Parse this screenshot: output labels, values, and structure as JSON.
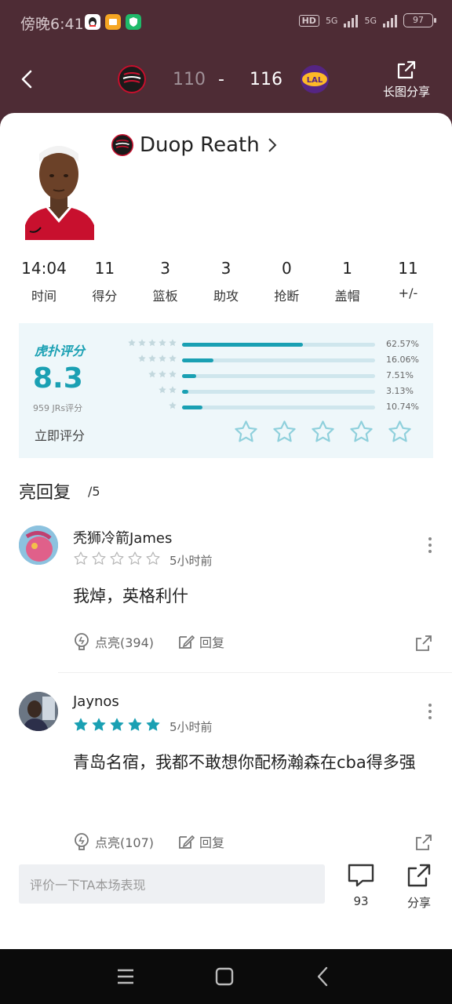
{
  "status_bar": {
    "time": "傍晚6:41",
    "hd": "HD",
    "net1": "5G",
    "net2": "5G",
    "battery": "97"
  },
  "header": {
    "score_home": "110",
    "score_sep": "-",
    "score_away": "116",
    "share_label": "长图分享"
  },
  "player": {
    "name": "Duop Reath"
  },
  "stats": [
    {
      "value": "14:04",
      "label": "时间"
    },
    {
      "value": "11",
      "label": "得分"
    },
    {
      "value": "3",
      "label": "篮板"
    },
    {
      "value": "3",
      "label": "助攻"
    },
    {
      "value": "0",
      "label": "抢断"
    },
    {
      "value": "1",
      "label": "盖帽"
    },
    {
      "value": "11",
      "label": "+/-"
    }
  ],
  "rating": {
    "brand": "虎扑评分",
    "score": "8.3",
    "count_text": "959 JRs评分",
    "rate_now": "立即评分",
    "distribution": [
      {
        "stars": 5,
        "pct_text": "62.57%",
        "pct": 62.57
      },
      {
        "stars": 4,
        "pct_text": "16.06%",
        "pct": 16.06
      },
      {
        "stars": 3,
        "pct_text": "7.51%",
        "pct": 7.51
      },
      {
        "stars": 2,
        "pct_text": "3.13%",
        "pct": 3.13
      },
      {
        "stars": 1,
        "pct_text": "10.74%",
        "pct": 10.74
      }
    ]
  },
  "replies": {
    "title": "亮回复",
    "count": "/5",
    "items": [
      {
        "user": "秃狮冷箭James",
        "stars": 0,
        "time": "5小时前",
        "text": "我焯，英格利什",
        "light": "点亮(394)",
        "reply": "回复"
      },
      {
        "user": "Jaynos",
        "stars": 5,
        "time": "5小时前",
        "text": "青岛名宿，我都不敢想你配杨瀚森在cba得多强",
        "light": "点亮(107)",
        "reply": "回复"
      }
    ]
  },
  "bottom": {
    "input_placeholder": "评价一下TA本场表现",
    "comments_count": "93",
    "share_label": "分享"
  },
  "colors": {
    "header_bg": "#4e2c35",
    "accent": "#1aa0b3",
    "rating_bg": "#eef7fa"
  }
}
